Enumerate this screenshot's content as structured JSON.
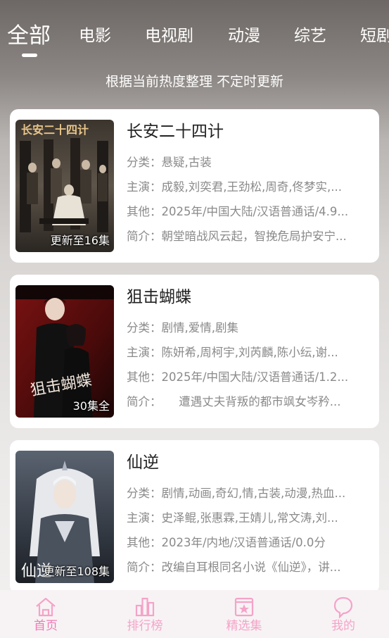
{
  "top_tabs": [
    {
      "label": "全部",
      "active": true
    },
    {
      "label": "电影",
      "active": false
    },
    {
      "label": "电视剧",
      "active": false
    },
    {
      "label": "动漫",
      "active": false
    },
    {
      "label": "综艺",
      "active": false
    },
    {
      "label": "短剧",
      "active": false
    }
  ],
  "subtitle": "根据当前热度整理 不定时更新",
  "items": [
    {
      "title": "长安二十四计",
      "badge": "更新至16集",
      "genre_label": "分类：",
      "genre": "悬疑,古装",
      "cast_label": "主演：",
      "cast": "成毅,刘奕君,王劲松,周奇,佟梦实,...",
      "other_label": "其他：",
      "other": "2025年/中国大陆/汉语普通话/4.9...",
      "intro_label": "简介：",
      "intro": "朝堂暗战风云起，智挽危局护安宁..."
    },
    {
      "title": "狙击蝴蝶",
      "badge": "30集全",
      "genre_label": "分类：",
      "genre": "剧情,爱情,剧集",
      "cast_label": "主演：",
      "cast": "陈妍希,周柯宇,刘芮麟,陈小纭,谢...",
      "other_label": "其他：",
      "other": "2025年/中国大陆/汉语普通话/1.2...",
      "intro_label": "简介：",
      "intro": "　　遭遇丈夫背叛的都市飒女岑矜..."
    },
    {
      "title": "仙逆",
      "badge": "更新至108集",
      "genre_label": "分类：",
      "genre": "剧情,动画,奇幻,情,古装,动漫,热血...",
      "cast_label": "主演：",
      "cast": "史泽鲲,张惠霖,王婧儿,常文涛,刘...",
      "other_label": "其他：",
      "other": "2023年/内地/汉语普通话/0.0分",
      "intro_label": "简介：",
      "intro": "改编自耳根同名小说《仙逆》，讲..."
    }
  ],
  "bottom_nav": [
    {
      "label": "首页",
      "icon": "home-icon",
      "active": true
    },
    {
      "label": "排行榜",
      "icon": "chart-icon",
      "active": false
    },
    {
      "label": "精选集",
      "icon": "star-box-icon",
      "active": false
    },
    {
      "label": "我的",
      "icon": "user-icon",
      "active": false
    }
  ],
  "colors": {
    "accent": "#f07ab4",
    "nav_inactive": "#f5a3c8"
  }
}
